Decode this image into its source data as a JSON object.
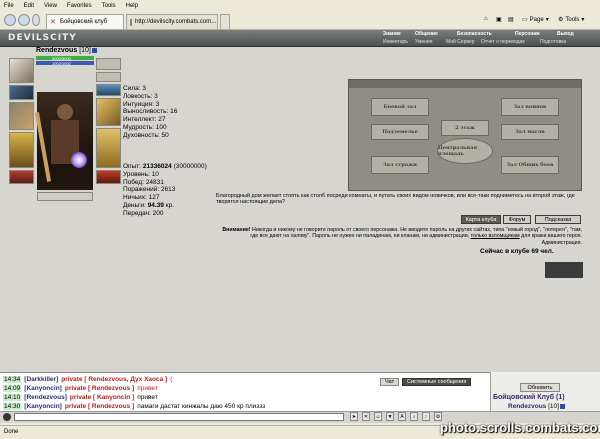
{
  "browser": {
    "menu": [
      "File",
      "Edit",
      "View",
      "Favorites",
      "Tools",
      "Help"
    ],
    "tabs": [
      {
        "label": "Бойцовский клуб"
      },
      {
        "label": "http://devilscity.combats.com..."
      }
    ],
    "tools": {
      "page": "Page",
      "tools": "Tools"
    }
  },
  "game": {
    "logo": "DEVILSCITY",
    "main_nav": [
      "Знание",
      "Общение",
      "Безопасность",
      "Персонаж",
      "Выход"
    ],
    "sub_nav": [
      "Инвентарь",
      "Умения",
      "Мой Сервер",
      "Отчет о переводах",
      "Подготовка"
    ],
    "character": {
      "name": "Rendezvous",
      "level": "[10]",
      "hp": "5000/5000",
      "mana": "1002/1002",
      "stats": [
        "Сила: 3",
        "Ловкость: 3",
        "Интуиция: 3",
        "Выносливость: 16",
        "Интеллект: 27",
        "Мудрость: 100",
        "Духовность: 50"
      ],
      "exp_label": "Опыт:",
      "exp_value": "21336024",
      "exp_next": "(30000000)",
      "level_line": "Уровень: 10",
      "wins": "Побед: 24831",
      "losses": "Поражений: 2613",
      "draws": "Ничьих: 127",
      "money_label": "Деньги:",
      "money_value": "94.39",
      "money_unit": "кр.",
      "transfers": "Передач: 200"
    },
    "map": {
      "rooms": [
        "Боевой зал",
        "Зал воинов",
        "Подземелье",
        "2 этаж",
        "Зал магов",
        "Центральная площадь",
        "Зал стражи",
        "Зал Общих боев"
      ]
    },
    "flavor_text": "Благородный дом желает стоять как столб посреди комнаты, и путать своих видом новичков, или все-таки подниметесь на второй этаж, где творятся настоящие дела?",
    "buttons": [
      "Карта клуба",
      "Форум",
      "Подсказка"
    ],
    "warning_title": "Внимание!",
    "warning_text": "Никогда и никому не говорите пароль от своего персонажа. Не вводите пароль на других сайтах, типа \"новый город\", \"лотерея\", \"там, где все дают на халяву\". Пароль не нужен ни паладинам, ни кланам, ни администрации,",
    "warning_link": "только взломщикам",
    "warning_tail": "для кражи вашего героя.",
    "admin": "Администрация.",
    "online": "Сейчас в клубе 69 чел."
  },
  "chat": {
    "tabs": [
      "Чат",
      "Системные сообщения"
    ],
    "lines": [
      {
        "time": "14:34",
        "nick": "[Darkkiller]",
        "priv": "private [ Rendezvous, Дух Хаоса ]",
        "msg": "(",
        "dark": false
      },
      {
        "time": "14:09",
        "nick": "[Kanyoncin]",
        "priv": "private [ Rendezvous ]",
        "msg": "привет",
        "dark": false
      },
      {
        "time": "14:10",
        "nick": "[Rendezvous]",
        "priv": "private [ Kanyoncin ]",
        "msg": "привет",
        "dark": true
      },
      {
        "time": "14:30",
        "nick": "[Kanyoncin]",
        "priv": "private [ Rendezvous ]",
        "msg": "памаги дастат кинжалы даю 450 кр плиззз",
        "dark": true
      }
    ],
    "update_button": "Обновить",
    "club_title": "Бойцовский Клуб (1)",
    "club_member": "Rendezvous",
    "club_member_level": "[10]"
  },
  "status": {
    "text": "Done"
  },
  "watermark": "photo.scrolls.combats.com"
}
